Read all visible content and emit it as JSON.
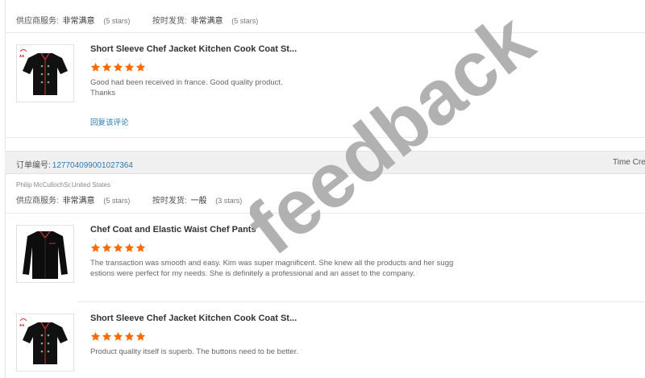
{
  "top_review": {
    "supplier_label": "供应商服务:",
    "supplier_value": "非常满意",
    "supplier_stars": "(5 stars)",
    "shipping_label": "按时发货:",
    "shipping_value": "非常满意",
    "shipping_stars": "(5 stars)",
    "item": {
      "title": "Short Sleeve Chef Jacket Kitchen Cook Coat St...",
      "rating": 5,
      "text_line1": "Good had been received in france. Good quality product.",
      "text_line2": "Thanks",
      "reply_label": "回复该评论",
      "thumb_icon": "chef-jacket-short-sleeve"
    }
  },
  "order": {
    "label": "订单编号:",
    "number": "127704099001027364",
    "time_label": "Time Cre",
    "buyer": "Philip McCullochSr,United States",
    "supplier_label": "供应商服务:",
    "supplier_value": "非常满意",
    "supplier_stars": "(5 stars)",
    "shipping_label": "按时发货:",
    "shipping_value": "一般",
    "shipping_stars": "(3 stars)",
    "items": [
      {
        "title": "Chef Coat and Elastic Waist Chef Pants",
        "rating": 5,
        "text_line1": "The transaction was smooth and easy. Kim was super magnificent. She knew all the products and her sugg",
        "text_line2": "estions were perfect for my needs. She is definitely a professional and an asset to the company.",
        "thumb_icon": "chef-coat-long-sleeve"
      },
      {
        "title": "Short Sleeve Chef Jacket Kitchen Cook Coat St...",
        "rating": 5,
        "text_line1": "Product quality itself is superb. The buttons need to be better.",
        "thumb_icon": "chef-jacket-short-sleeve"
      }
    ]
  },
  "watermark": {
    "text": "feedback",
    "color": "#a9a9a9"
  },
  "colors": {
    "star": "#ff6a00",
    "link": "#2a7ab7",
    "order_bar": "#f0f0f0"
  }
}
